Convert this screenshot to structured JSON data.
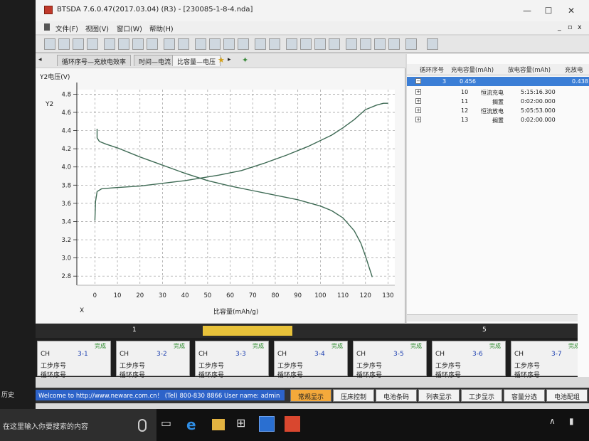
{
  "window": {
    "title": "BTSDA 7.6.0.47(2017.03.04) (R3) - [230085-1-8-4.nda]",
    "controls": {
      "minimize": "—",
      "maximize": "☐",
      "close": "✕"
    },
    "inner_controls": {
      "minimize": "_",
      "restore": "▫",
      "close": "x"
    }
  },
  "menu": [
    "文件(F)",
    "视图(V)",
    "窗口(W)",
    "帮助(H)"
  ],
  "tabs": {
    "nav_left": "◂",
    "items": [
      "循环序号—充放电效率",
      "时间—电流",
      "比容量—电压"
    ],
    "nav_right": "▸",
    "active_index": 2
  },
  "chart_data": {
    "type": "line",
    "ylabel": "Y2电压(V)",
    "y_axis_name": "Y2",
    "xlabel": "比容量(mAh/g)",
    "x_axis_name": "X",
    "xlim": [
      -8,
      133
    ],
    "ylim": [
      2.7,
      4.85
    ],
    "x_ticks": [
      0,
      10,
      20,
      30,
      40,
      50,
      60,
      70,
      80,
      90,
      100,
      110,
      120,
      130
    ],
    "y_ticks": [
      "4.8",
      "4.6",
      "4.4",
      "4.2",
      "4.0",
      "3.8",
      "3.6",
      "3.4",
      "3.2",
      "3.0",
      "2.8"
    ],
    "grid": true,
    "series": [
      {
        "color": "#3f6b55",
        "x": [
          0,
          0.3,
          1,
          3,
          8,
          20,
          40,
          55,
          65,
          75,
          85,
          95,
          105,
          110,
          115,
          120,
          125,
          128,
          130
        ],
        "y": [
          3.41,
          3.62,
          3.73,
          3.76,
          3.77,
          3.79,
          3.85,
          3.91,
          3.96,
          4.04,
          4.13,
          4.23,
          4.35,
          4.43,
          4.52,
          4.63,
          4.68,
          4.7,
          4.7
        ]
      },
      {
        "color": "#3f6b55",
        "x": [
          1,
          1,
          2,
          5,
          10,
          20,
          30,
          40,
          50,
          60,
          70,
          80,
          90,
          100,
          105,
          110,
          115,
          118,
          120,
          123
        ],
        "y": [
          4.42,
          4.32,
          4.28,
          4.25,
          4.21,
          4.11,
          4.02,
          3.93,
          3.85,
          3.79,
          3.74,
          3.69,
          3.64,
          3.57,
          3.52,
          3.44,
          3.3,
          3.16,
          3.02,
          2.79
        ]
      }
    ]
  },
  "grid_table": {
    "headers": [
      "循环序号",
      "充电容量(mAh)",
      "放电容量(mAh)",
      "充放电"
    ],
    "summary_row": {
      "cycle": "3",
      "charge": "0.456",
      "discharge": "0.438"
    },
    "steps": [
      {
        "expander": "+",
        "no": "10",
        "type": "恒流充电",
        "time": "5:15:16.300"
      },
      {
        "expander": "+",
        "no": "11",
        "type": "搁置",
        "time": "0:02:00.000"
      },
      {
        "expander": "+",
        "no": "12",
        "type": "恒流放电",
        "time": "5:05:53.000"
      },
      {
        "expander": "+",
        "no": "13",
        "type": "搁置",
        "time": "0:02:00.000"
      }
    ],
    "collapse_glyph": "−"
  },
  "scrollbar": {
    "left_label": "1",
    "right_label": "5",
    "position": 0.36
  },
  "channels": [
    {
      "status": "完成",
      "ch": "CH",
      "id": "3-1",
      "row2": "工步序号",
      "row3": "循环序号"
    },
    {
      "status": "完成",
      "ch": "CH",
      "id": "3-2",
      "row2": "工步序号",
      "row3": "循环序号"
    },
    {
      "status": "完成",
      "ch": "CH",
      "id": "3-3",
      "row2": "工步序号",
      "row3": "循环序号"
    },
    {
      "status": "完成",
      "ch": "CH",
      "id": "3-4",
      "row2": "工步序号",
      "row3": "循环序号"
    },
    {
      "status": "完成",
      "ch": "CH",
      "id": "3-5",
      "row2": "工步序号",
      "row3": "循环序号"
    },
    {
      "status": "完成",
      "ch": "CH",
      "id": "3-6",
      "row2": "工步序号",
      "row3": "循环序号"
    },
    {
      "status": "完成",
      "ch": "CH",
      "id": "3-7",
      "row2": "工步序号",
      "row3": "循环序号"
    }
  ],
  "status": {
    "message": "Welcome to http://www.neware.com.cn！ (Tel) 800-830 8866 User name: admin",
    "buttons": [
      "常规显示",
      "压床控制",
      "电池条码",
      "列表显示",
      "工步显示",
      "容量分选",
      "电池配组"
    ],
    "active_index": 0
  },
  "left_edge": {
    "history": "历史"
  },
  "taskbar": {
    "search_placeholder": "在这里输入你要搜索的内容"
  },
  "colors": {
    "accent": "#3b7ed6",
    "curve": "#3f6b55",
    "active_button": "#f4a93b",
    "scroll_thumb": "#e8c23a",
    "status_ok": "#2b8a2b"
  }
}
